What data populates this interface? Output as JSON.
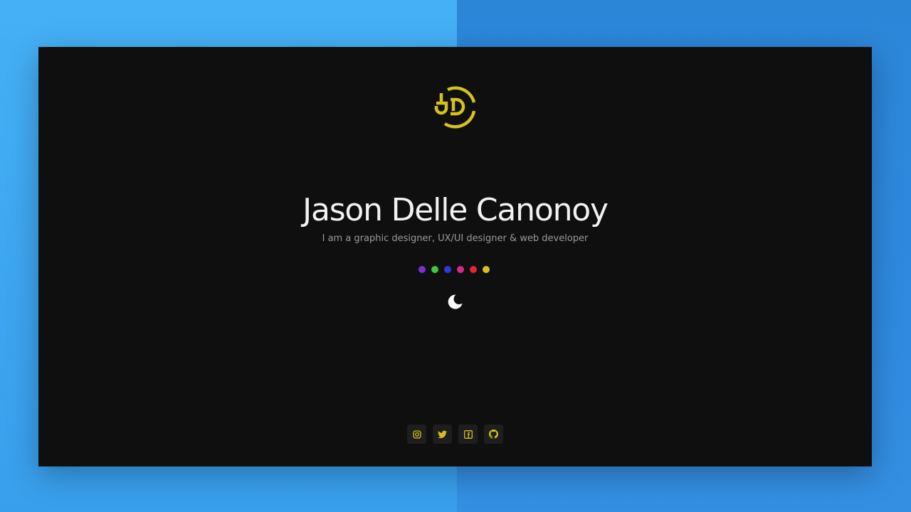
{
  "profile": {
    "name": "Jason Delle Canonoy",
    "tagline": "I am a graphic designer, UX/UI designer & web developer"
  },
  "logo": {
    "icon": "jd-monogram-logo",
    "color": "#d4c11f"
  },
  "theme_colors": [
    {
      "name": "purple",
      "color": "#7a2fd6"
    },
    {
      "name": "green",
      "color": "#3ec63e"
    },
    {
      "name": "blue",
      "color": "#2a3ae0"
    },
    {
      "name": "pink",
      "color": "#d42a8c"
    },
    {
      "name": "red",
      "color": "#e0262e"
    },
    {
      "name": "yellow",
      "color": "#d8bf1e"
    }
  ],
  "theme_toggle": {
    "icon": "moon-icon",
    "color": "#ffffff"
  },
  "socials": [
    {
      "name": "instagram",
      "icon": "instagram-icon"
    },
    {
      "name": "twitter",
      "icon": "twitter-icon"
    },
    {
      "name": "facebook",
      "icon": "facebook-icon"
    },
    {
      "name": "github",
      "icon": "github-icon"
    }
  ],
  "colors": {
    "accent": "#d4c11f",
    "panel_background": "#0f0f0f",
    "title": "#f2f2f2",
    "subtitle": "#9a9a9a"
  }
}
